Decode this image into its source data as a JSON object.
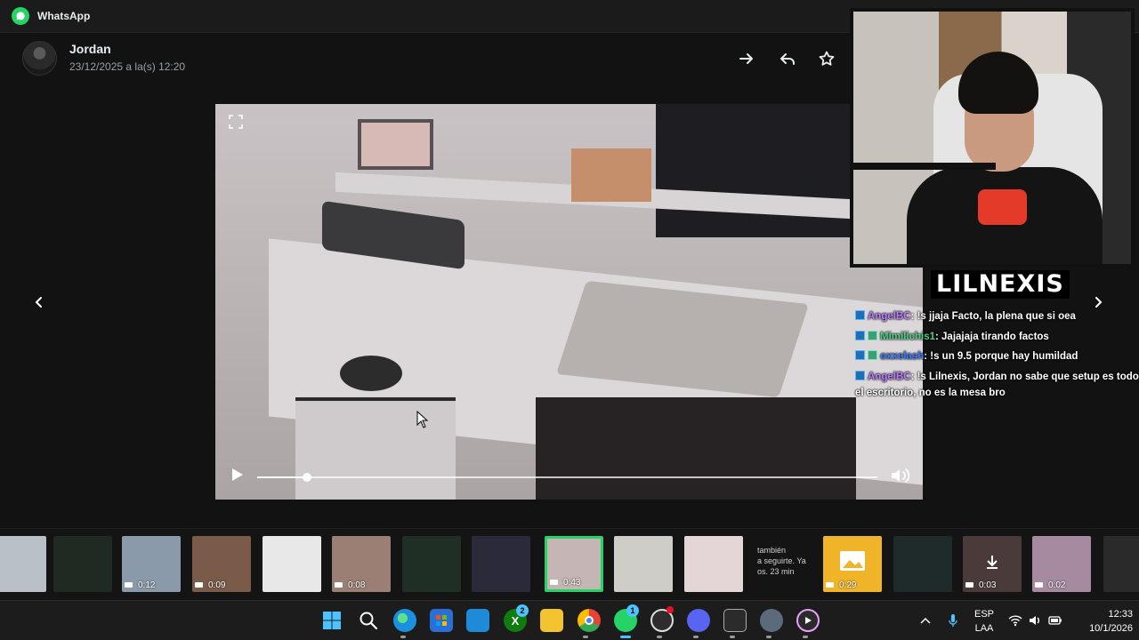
{
  "app": {
    "title": "WhatsApp"
  },
  "header": {
    "contact_name": "Jordan",
    "timestamp": "23/12/2025 a la(s) 12:20",
    "actions": [
      {
        "name": "forward-icon"
      },
      {
        "name": "reply-icon"
      },
      {
        "name": "star-icon"
      }
    ]
  },
  "media": {
    "type": "video",
    "progress": 0.08,
    "controls": [
      "expand-icon",
      "play-icon",
      "volume-icon"
    ]
  },
  "overlay": {
    "streamer_name": "LILNEXIS",
    "chat": [
      {
        "user": "AngelBC",
        "message": ": !s jjaja Facto, la plena que si oea"
      },
      {
        "user": "Mimilichis1",
        "message": ": Jajajaja tirando factos"
      },
      {
        "user": "oxxelash",
        "message": ": !s un 9.5 porque hay humildad"
      },
      {
        "user": "AngelBC",
        "message": ": !s Lilnexis, Jordan no sabe que setup es todo el escritorio, no es la mesa bro"
      }
    ]
  },
  "thumbnails": [
    {
      "duration": "",
      "text": ""
    },
    {
      "duration": "",
      "text": ""
    },
    {
      "duration": "0:12",
      "text": ""
    },
    {
      "duration": "0:09",
      "text": ""
    },
    {
      "duration": "",
      "text": ""
    },
    {
      "duration": "0:08",
      "text": ""
    },
    {
      "duration": "",
      "text": ""
    },
    {
      "duration": "",
      "text": ""
    },
    {
      "duration": "0:43",
      "text": ""
    },
    {
      "duration": "",
      "text": ""
    },
    {
      "duration": "",
      "text": ""
    },
    {
      "duration": "",
      "text": "también\na seguirte. Ya\nos. 23 min"
    },
    {
      "duration": "0:29",
      "text": ""
    },
    {
      "duration": "",
      "text": ""
    },
    {
      "duration": "0:03",
      "text": ""
    },
    {
      "duration": "0:02",
      "text": ""
    },
    {
      "duration": "",
      "text": ""
    }
  ],
  "taskbar": {
    "apps": [
      "windows-start-icon",
      "search-icon",
      "edge-icon",
      "store-icon",
      "widgets-icon",
      "xbox-icon",
      "file-explorer-icon",
      "chrome-icon",
      "whatsapp-icon",
      "chatgpt-icon",
      "discord-icon",
      "obs-icon",
      "settings-icon",
      "media-player-icon"
    ],
    "xbox_badge": "2",
    "whatsapp_badge": "1",
    "language": "ESP",
    "layout": "LAA",
    "time": "12:33",
    "date": "10/1/2026"
  },
  "colors": {
    "accent": "#25d366",
    "background": "#121212"
  }
}
